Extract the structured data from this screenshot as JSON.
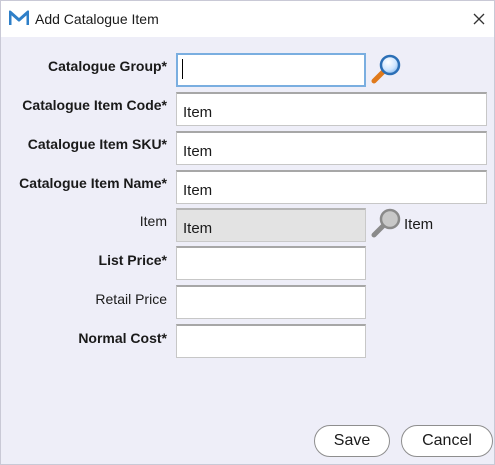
{
  "window": {
    "title": "Add Catalogue Item",
    "logo_icon": "m-logo-icon",
    "close_icon": "close-icon"
  },
  "form": {
    "catalogue_group": {
      "label": "Catalogue Group*",
      "value": "",
      "icon": "magnifier-icon"
    },
    "item_code": {
      "label": "Catalogue Item Code*",
      "value": "Item"
    },
    "item_sku": {
      "label": "Catalogue Item SKU*",
      "value": "Item"
    },
    "item_name": {
      "label": "Catalogue Item Name*",
      "value": "Item"
    },
    "item": {
      "label": "Item",
      "value": "Item",
      "icon": "magnifier-disabled-icon",
      "side_text": "Item"
    },
    "list_price": {
      "label": "List Price*",
      "value": ""
    },
    "retail_price": {
      "label": "Retail Price",
      "value": ""
    },
    "normal_cost": {
      "label": "Normal Cost*",
      "value": ""
    }
  },
  "buttons": {
    "save": "Save",
    "cancel": "Cancel"
  },
  "colors": {
    "background": "#eeeef8",
    "focus_border": "#7aaee0",
    "readonly_field": "#e3e3e3"
  }
}
